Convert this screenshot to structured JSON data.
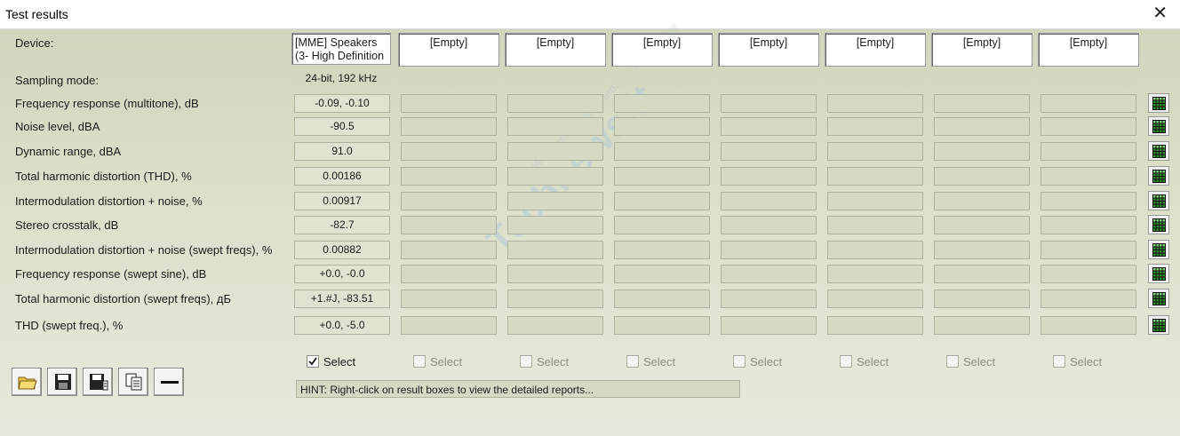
{
  "window": {
    "title": "Test results"
  },
  "labels": {
    "device": "Device:",
    "sampling_mode": "Sampling mode:",
    "tests": [
      "Frequency response (multitone), dB",
      "Noise level, dBA",
      "Dynamic range, dBA",
      "Total harmonic distortion (THD), %",
      "Intermodulation distortion + noise, %",
      "Stereo crosstalk, dB",
      "Intermodulation distortion + noise (swept freqs), %",
      "Frequency response (swept sine), dB",
      "Total harmonic distortion (swept freqs), дБ",
      "THD (swept freq.), %"
    ]
  },
  "devices": [
    "[MME] Speakers (3- High Definition",
    "[Empty]",
    "[Empty]",
    "[Empty]",
    "[Empty]",
    "[Empty]",
    "[Empty]",
    "[Empty]"
  ],
  "sampling_modes": [
    "24-bit, 192 kHz",
    "",
    "",
    "",
    "",
    "",
    "",
    ""
  ],
  "results_col1": [
    "-0.09, -0.10",
    "-90.5",
    "91.0",
    "0.00186",
    "0.00917",
    "-82.7",
    "0.00882",
    "+0.0, -0.0",
    "+1.#J, -83.51",
    "+0.0, -5.0"
  ],
  "select": {
    "label": "Select",
    "checked": [
      true,
      false,
      false,
      false,
      false,
      false,
      false,
      false
    ]
  },
  "hint": "HINT: Right-click on result boxes to view the detailed reports...",
  "toolbar": [
    "open-folder-icon",
    "save-icon",
    "save-as-icon",
    "copy-icon",
    "minus-icon"
  ],
  "watermark": {
    "main": "Techhews.lt",
    "tagline": "Where geeks meet hardware and software"
  },
  "colors": {
    "panel": "#d2d6bd",
    "result_box": "#d6d9c4",
    "grid_icon": "#2e8b2e"
  }
}
